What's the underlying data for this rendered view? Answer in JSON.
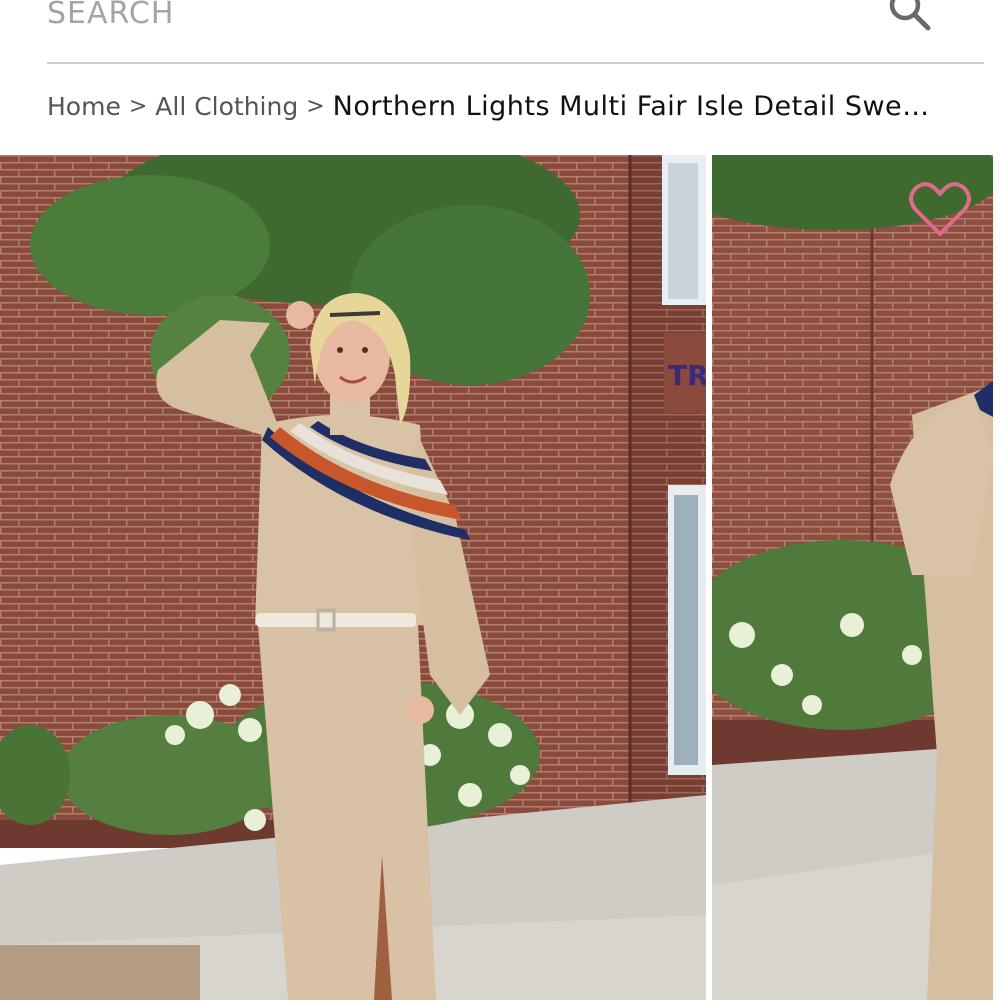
{
  "search": {
    "placeholder": "SEARCH",
    "icon": "search-icon"
  },
  "breadcrumb": {
    "home": "Home",
    "separator": ">",
    "category": "All Clothing",
    "current": "Northern Lights Multi Fair Isle Detail Swe…"
  },
  "gallery": {
    "main_image": "model-in-beige-fair-isle-sweater-dress",
    "second_image": "model-in-beige-fair-isle-sweater-dress-side-view",
    "storefront_sign": "TRU",
    "wishlist_icon": "heart-outline-icon"
  },
  "colors": {
    "text": "#555555",
    "text_dark": "#111111",
    "divider": "#cfcfcf",
    "wishlist": "#e06a8c"
  }
}
